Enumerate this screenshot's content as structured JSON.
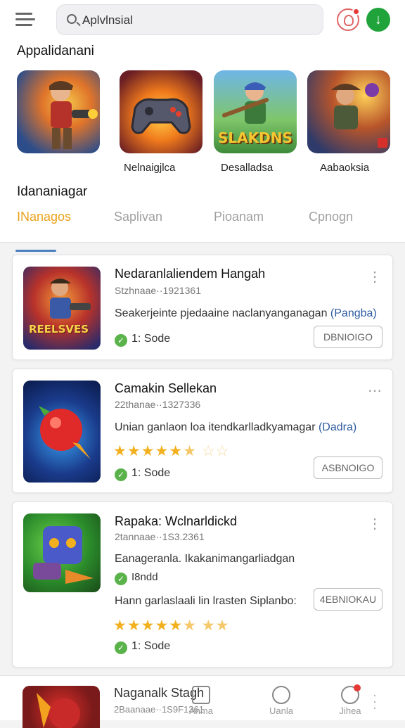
{
  "search": {
    "value": "Aplvlnsial",
    "placeholder": "Aplvlnsial"
  },
  "featured": {
    "title": "Appalidanani",
    "items": [
      {
        "label": ""
      },
      {
        "label": "Nelnaigjlca"
      },
      {
        "label": "Desalladsa",
        "badge_text": "SLAKDNS"
      },
      {
        "label": "Aabaoksia"
      }
    ]
  },
  "section2": {
    "title": "Idananiagar"
  },
  "tabs": [
    "INanagos",
    "Saplivan",
    "Pioanam",
    "Cpnogn"
  ],
  "cards": [
    {
      "title": "Nedaranlaliendem Hangah",
      "meta": "Stzhnaae··1921361",
      "desc": "Seakerjeinte pjedaaine naclanyanganagan",
      "link": "(Pangba)",
      "size": "1: Sode",
      "button": "DBNIOIGO",
      "thumb_text": "REELSVES"
    },
    {
      "title": "Camakin Sellekan",
      "meta": "22thanae··1327336",
      "desc": "Unian ganlaon loa itendkarlladkyamagar",
      "link": "(Dadra)",
      "rating": 4.5,
      "size": "1: Sode",
      "button": "ASBNOIGO"
    },
    {
      "title": "Rapaka: Wclnarldickd",
      "meta": "2tannaae··1S3.2361",
      "desc": "Eanageranla. Ikakanimangarliadgan",
      "check_label": "I8ndd",
      "desc2": "Hann garlaslaali lin lrasten Siplanbo:",
      "rating": 4.5,
      "size": "1: Sode",
      "button": "4EBNIOKAU"
    }
  ],
  "bottom_card": {
    "title": "Naganalk Stagh",
    "meta": "2Baanaae··1S9F1361"
  },
  "nav": [
    {
      "label": "Anma",
      "icon": "home-icon"
    },
    {
      "label": "Uanla",
      "icon": "compass-icon"
    },
    {
      "label": "Jihea",
      "icon": "profile-icon"
    }
  ],
  "colors": {
    "accent_tab": "#e9a21a",
    "tab_indicator": "#4a7fc0",
    "download_green": "#1fa33a",
    "link_blue": "#2c5aa0",
    "star": "#f2b01e"
  }
}
